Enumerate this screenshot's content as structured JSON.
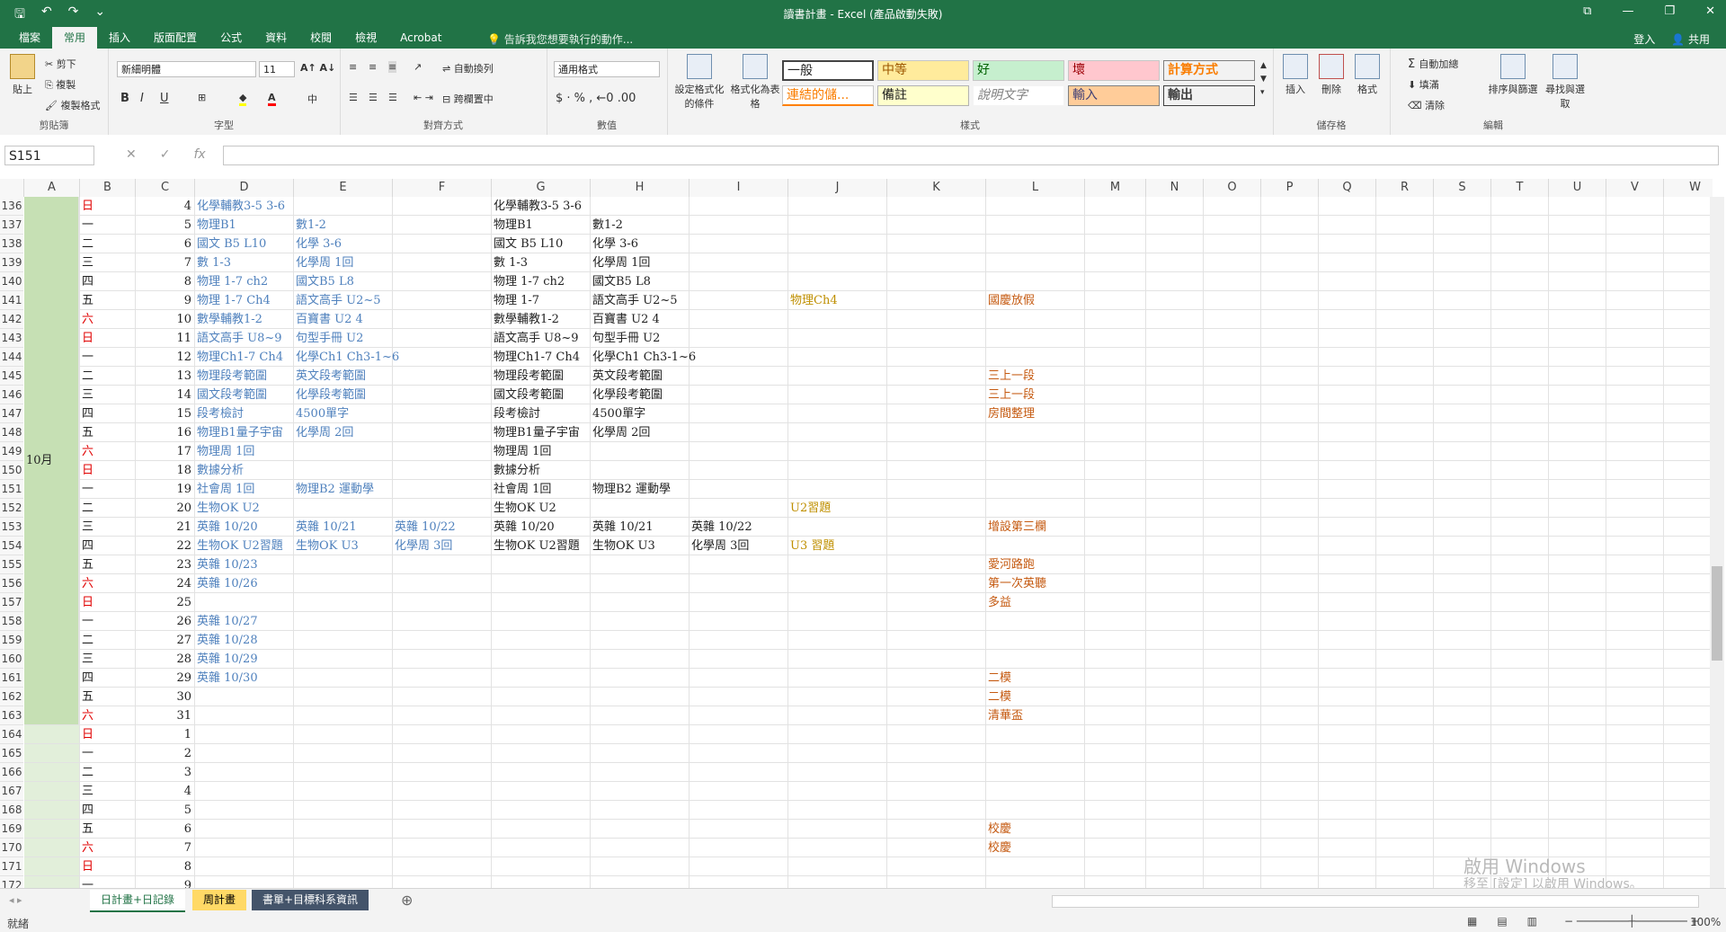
{
  "window": {
    "title": "讀書計畫 - Excel (產品啟動失敗)",
    "controls": [
      "⧉",
      "—",
      "❐",
      "✕"
    ]
  },
  "qat": [
    "🖫",
    "↶",
    "↷",
    "⌄"
  ],
  "ribbon_tabs": [
    "檔案",
    "常用",
    "插入",
    "版面配置",
    "公式",
    "資料",
    "校閱",
    "檢視",
    "Acrobat"
  ],
  "tell_me": "告訴我您想要執行的動作...",
  "account": {
    "signin": "登入",
    "share": "共用"
  },
  "ribbon": {
    "clipboard": {
      "paste": "貼上",
      "cut": "剪下",
      "copy": "複製",
      "painter": "複製格式",
      "label": "剪貼簿"
    },
    "font": {
      "name": "新細明體",
      "size": "11",
      "label": "字型"
    },
    "alignment": {
      "wrap": "自動換列",
      "merge": "跨欄置中",
      "label": "對齊方式"
    },
    "number": {
      "format": "通用格式",
      "label": "數值"
    },
    "styles": {
      "cond": "設定格式化的條件",
      "table": "格式化為表格",
      "items": [
        "一般",
        "中等",
        "好",
        "壞",
        "計算方式",
        "連結的儲...",
        "備註",
        "說明文字",
        "輸入",
        "輸出"
      ],
      "label": "樣式"
    },
    "cells": {
      "insert": "插入",
      "delete": "刪除",
      "format": "格式",
      "label": "儲存格"
    },
    "editing": {
      "autosum": "自動加總",
      "fill": "填滿",
      "clear": "清除",
      "sort": "排序與篩選",
      "find": "尋找與選取",
      "label": "編輯"
    }
  },
  "formula_bar": {
    "name_box": "S151",
    "fx": "fx",
    "value": ""
  },
  "columns": [
    "A",
    "B",
    "C",
    "D",
    "E",
    "F",
    "G",
    "H",
    "I",
    "J",
    "K",
    "L",
    "M",
    "N",
    "O",
    "P",
    "Q",
    "R",
    "S",
    "T",
    "U",
    "V",
    "W"
  ],
  "month_label": "10月",
  "rows": [
    {
      "r": "136",
      "b": "日",
      "c": "4",
      "d": "化學輔教3-5 3-6",
      "e": "",
      "f": "",
      "g": "化學輔教3-5 3-6",
      "h": "",
      "i": "",
      "j": "",
      "l": ""
    },
    {
      "r": "137",
      "b": "一",
      "c": "5",
      "d": "物理B1",
      "e": "數1-2",
      "f": "",
      "g": "物理B1",
      "h": "數1-2",
      "i": "",
      "j": "",
      "l": ""
    },
    {
      "r": "138",
      "b": "二",
      "c": "6",
      "d": "國文 B5 L10",
      "e": "化學 3-6",
      "f": "",
      "g": "國文 B5 L10",
      "h": "化學 3-6",
      "i": "",
      "j": "",
      "l": ""
    },
    {
      "r": "139",
      "b": "三",
      "c": "7",
      "d": "數 1-3",
      "e": "化學周 1回",
      "f": "",
      "g": "數 1-3",
      "h": "化學周 1回",
      "i": "",
      "j": "",
      "l": ""
    },
    {
      "r": "140",
      "b": "四",
      "c": "8",
      "d": "物理 1-7 ch2",
      "e": "國文B5 L8",
      "f": "",
      "g": "物理 1-7 ch2",
      "h": "國文B5 L8",
      "i": "",
      "j": "",
      "l": ""
    },
    {
      "r": "141",
      "b": "五",
      "c": "9",
      "d": "物理 1-7 Ch4",
      "e": "語文高手 U2~5",
      "f": "",
      "g": "物理 1-7",
      "h": "語文高手 U2~5",
      "i": "",
      "j": "物理Ch4",
      "l": "國慶放假"
    },
    {
      "r": "142",
      "b": "六",
      "c": "10",
      "d": "數學輔教1-2",
      "e": "百寶書 U2 4",
      "f": "",
      "g": "數學輔教1-2",
      "h": "百寶書 U2 4",
      "i": "",
      "j": "",
      "l": ""
    },
    {
      "r": "143",
      "b": "日",
      "c": "11",
      "d": "語文高手 U8~9",
      "e": "句型手冊 U2",
      "f": "",
      "g": "語文高手 U8~9",
      "h": "句型手冊 U2",
      "i": "",
      "j": "",
      "l": ""
    },
    {
      "r": "144",
      "b": "一",
      "c": "12",
      "d": "物理Ch1-7 Ch4",
      "e": "化學Ch1 Ch3-1~6",
      "f": "",
      "g": "物理Ch1-7 Ch4",
      "h": "化學Ch1 Ch3-1~6",
      "i": "",
      "j": "",
      "l": ""
    },
    {
      "r": "145",
      "b": "二",
      "c": "13",
      "d": "物理段考範圍",
      "e": "英文段考範圍",
      "f": "",
      "g": "物理段考範圍",
      "h": "英文段考範圍",
      "i": "",
      "j": "",
      "l": "三上一段"
    },
    {
      "r": "146",
      "b": "三",
      "c": "14",
      "d": "國文段考範圍",
      "e": "化學段考範圍",
      "f": "",
      "g": "國文段考範圍",
      "h": "化學段考範圍",
      "i": "",
      "j": "",
      "l": "三上一段"
    },
    {
      "r": "147",
      "b": "四",
      "c": "15",
      "d": "段考檢討",
      "e": "4500單字",
      "f": "",
      "g": "段考檢討",
      "h": "4500單字",
      "i": "",
      "j": "",
      "l": "房間整理"
    },
    {
      "r": "148",
      "b": "五",
      "c": "16",
      "d": "物理B1量子宇宙",
      "e": "化學周 2回",
      "f": "",
      "g": "物理B1量子宇宙",
      "h": "化學周 2回",
      "i": "",
      "j": "",
      "l": ""
    },
    {
      "r": "149",
      "b": "六",
      "c": "17",
      "d": "物理周 1回",
      "e": "",
      "f": "",
      "g": "物理周 1回",
      "h": "",
      "i": "",
      "j": "",
      "l": ""
    },
    {
      "r": "150",
      "b": "日",
      "c": "18",
      "d": "數據分析",
      "e": "",
      "f": "",
      "g": "數據分析",
      "h": "",
      "i": "",
      "j": "",
      "l": ""
    },
    {
      "r": "151",
      "b": "一",
      "c": "19",
      "d": "社會周 1回",
      "e": "物理B2 運動學",
      "f": "",
      "g": "社會周 1回",
      "h": "物理B2 運動學",
      "i": "",
      "j": "",
      "l": ""
    },
    {
      "r": "152",
      "b": "二",
      "c": "20",
      "d": "生物OK U2",
      "e": "",
      "f": "",
      "g": "生物OK U2",
      "h": "",
      "i": "",
      "j": "U2習題",
      "l": ""
    },
    {
      "r": "153",
      "b": "三",
      "c": "21",
      "d": "英雜 10/20",
      "e": "英雜 10/21",
      "f": "英雜 10/22",
      "g": "英雜 10/20",
      "h": "英雜 10/21",
      "i": "英雜 10/22",
      "j": "",
      "l": "增設第三欄"
    },
    {
      "r": "154",
      "b": "四",
      "c": "22",
      "d": "生物OK U2習題",
      "e": "生物OK U3",
      "f": "化學周 3回",
      "g": "生物OK U2習題",
      "h": "生物OK U3",
      "i": "化學周 3回",
      "j": "U3 習題",
      "l": ""
    },
    {
      "r": "155",
      "b": "五",
      "c": "23",
      "d": "英雜 10/23",
      "e": "",
      "f": "",
      "g": "",
      "h": "",
      "i": "",
      "j": "",
      "l": "愛河路跑"
    },
    {
      "r": "156",
      "b": "六",
      "c": "24",
      "d": "英雜 10/26",
      "e": "",
      "f": "",
      "g": "",
      "h": "",
      "i": "",
      "j": "",
      "l": "第一次英聽"
    },
    {
      "r": "157",
      "b": "日",
      "c": "25",
      "d": "",
      "e": "",
      "f": "",
      "g": "",
      "h": "",
      "i": "",
      "j": "",
      "l": "多益"
    },
    {
      "r": "158",
      "b": "一",
      "c": "26",
      "d": "英雜 10/27",
      "e": "",
      "f": "",
      "g": "",
      "h": "",
      "i": "",
      "j": "",
      "l": ""
    },
    {
      "r": "159",
      "b": "二",
      "c": "27",
      "d": "英雜 10/28",
      "e": "",
      "f": "",
      "g": "",
      "h": "",
      "i": "",
      "j": "",
      "l": ""
    },
    {
      "r": "160",
      "b": "三",
      "c": "28",
      "d": "英雜 10/29",
      "e": "",
      "f": "",
      "g": "",
      "h": "",
      "i": "",
      "j": "",
      "l": ""
    },
    {
      "r": "161",
      "b": "四",
      "c": "29",
      "d": "英雜 10/30",
      "e": "",
      "f": "",
      "g": "",
      "h": "",
      "i": "",
      "j": "",
      "l": "二模"
    },
    {
      "r": "162",
      "b": "五",
      "c": "30",
      "d": "",
      "e": "",
      "f": "",
      "g": "",
      "h": "",
      "i": "",
      "j": "",
      "l": "二模"
    },
    {
      "r": "163",
      "b": "六",
      "c": "31",
      "d": "",
      "e": "",
      "f": "",
      "g": "",
      "h": "",
      "i": "",
      "j": "",
      "l": "清華盃"
    },
    {
      "r": "164",
      "b": "日",
      "c": "1",
      "d": "",
      "e": "",
      "f": "",
      "g": "",
      "h": "",
      "i": "",
      "j": "",
      "l": ""
    },
    {
      "r": "165",
      "b": "一",
      "c": "2",
      "d": "",
      "e": "",
      "f": "",
      "g": "",
      "h": "",
      "i": "",
      "j": "",
      "l": ""
    },
    {
      "r": "166",
      "b": "二",
      "c": "3",
      "d": "",
      "e": "",
      "f": "",
      "g": "",
      "h": "",
      "i": "",
      "j": "",
      "l": ""
    },
    {
      "r": "167",
      "b": "三",
      "c": "4",
      "d": "",
      "e": "",
      "f": "",
      "g": "",
      "h": "",
      "i": "",
      "j": "",
      "l": ""
    },
    {
      "r": "168",
      "b": "四",
      "c": "5",
      "d": "",
      "e": "",
      "f": "",
      "g": "",
      "h": "",
      "i": "",
      "j": "",
      "l": ""
    },
    {
      "r": "169",
      "b": "五",
      "c": "6",
      "d": "",
      "e": "",
      "f": "",
      "g": "",
      "h": "",
      "i": "",
      "j": "",
      "l": "校慶"
    },
    {
      "r": "170",
      "b": "六",
      "c": "7",
      "d": "",
      "e": "",
      "f": "",
      "g": "",
      "h": "",
      "i": "",
      "j": "",
      "l": "校慶"
    },
    {
      "r": "171",
      "b": "日",
      "c": "8",
      "d": "",
      "e": "",
      "f": "",
      "g": "",
      "h": "",
      "i": "",
      "j": "",
      "l": ""
    },
    {
      "r": "172",
      "b": "一",
      "c": "9",
      "d": "",
      "e": "",
      "f": "",
      "g": "",
      "h": "",
      "i": "",
      "j": "",
      "l": ""
    }
  ],
  "sheet_tabs": [
    "日計畫+日記錄",
    "周計畫",
    "書單+目標科系資訊"
  ],
  "status": {
    "ready": "就緒",
    "zoom": "100%"
  },
  "watermark": {
    "line1": "啟用 Windows",
    "line2": "移至 [設定] 以啟用 Windows。"
  },
  "colors": {
    "excel_green": "#217346",
    "month_fill": "#c6e0b4",
    "next_month_fill": "#e2efda"
  }
}
